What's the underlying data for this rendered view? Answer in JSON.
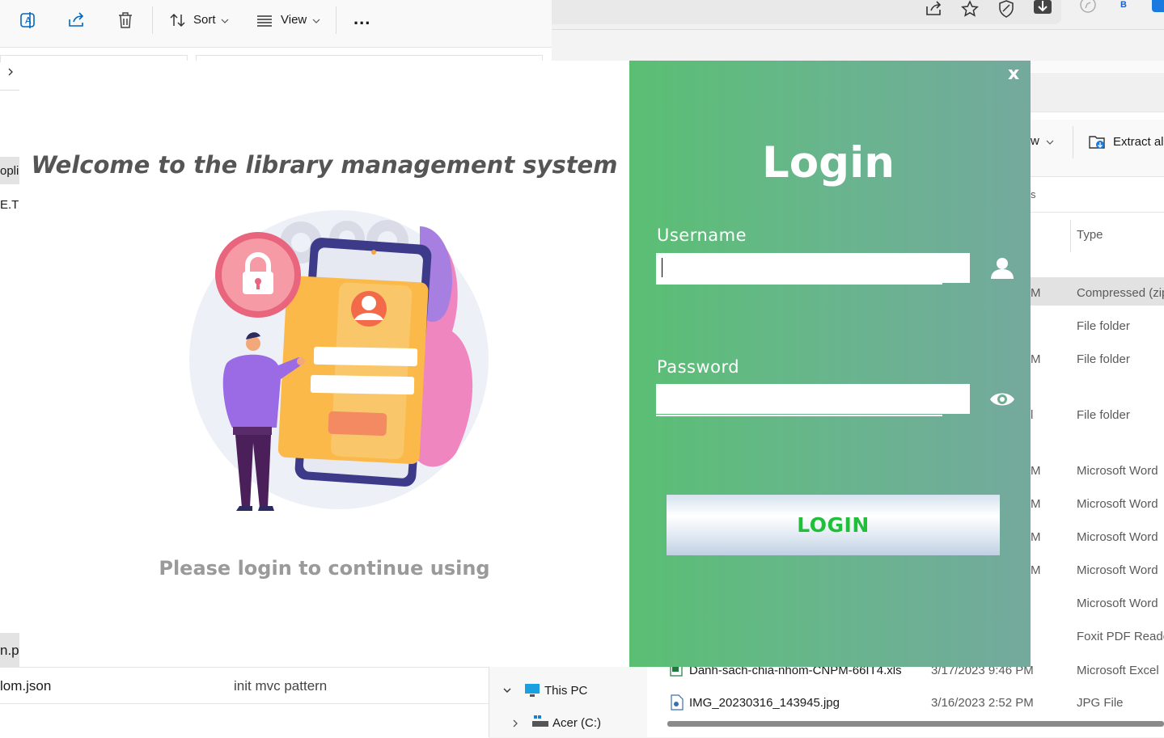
{
  "background": {
    "toolbar": {
      "sort_label": "Sort",
      "view_label": "View",
      "more_label": "..."
    },
    "left_fragments": [
      "opli",
      "E.TX",
      "n.py",
      "lom.json",
      "init mvc pattern"
    ],
    "nav": {
      "this_pc": "This PC",
      "drive": "Acer (C:)"
    },
    "right": {
      "view_fragment": "w",
      "extract_label": "Extract all",
      "search_fragment": "s",
      "type_header": "Type",
      "time_fragments": [
        "M",
        "M",
        "l",
        "M",
        "M",
        "M",
        "M"
      ],
      "type_values": [
        "Compressed (zip",
        "File folder",
        "File folder",
        "File folder",
        "Microsoft Word",
        "Microsoft Word",
        "Microsoft Word",
        "Microsoft Word",
        "Microsoft Word",
        "Foxit PDF Reade",
        "Microsoft Excel"
      ],
      "files": [
        {
          "name": "Danh-sach-chia-nhom-CNPM-66IT4.xls",
          "date": "3/17/2023 9:46 PM",
          "type": "Microsoft Excel"
        },
        {
          "name": "IMG_20230316_143945.jpg",
          "date": "3/16/2023 2:52 PM",
          "type": "JPG File"
        }
      ],
      "browser_profile": "B"
    }
  },
  "login_window": {
    "welcome_text": "Welcome to the library management system",
    "subtitle": "Please login to continue using",
    "close_label": "x",
    "title": "Login",
    "username_label": "Username",
    "username_value": "",
    "password_label": "Password",
    "password_value": "",
    "login_button": "LOGIN",
    "colors": {
      "panel_start": "#5abf73",
      "panel_end": "#74a99d",
      "button_text": "#1fbf3a"
    },
    "icons": {
      "username": "user-icon",
      "password": "eye-icon",
      "illustration": "login-illustration"
    }
  }
}
